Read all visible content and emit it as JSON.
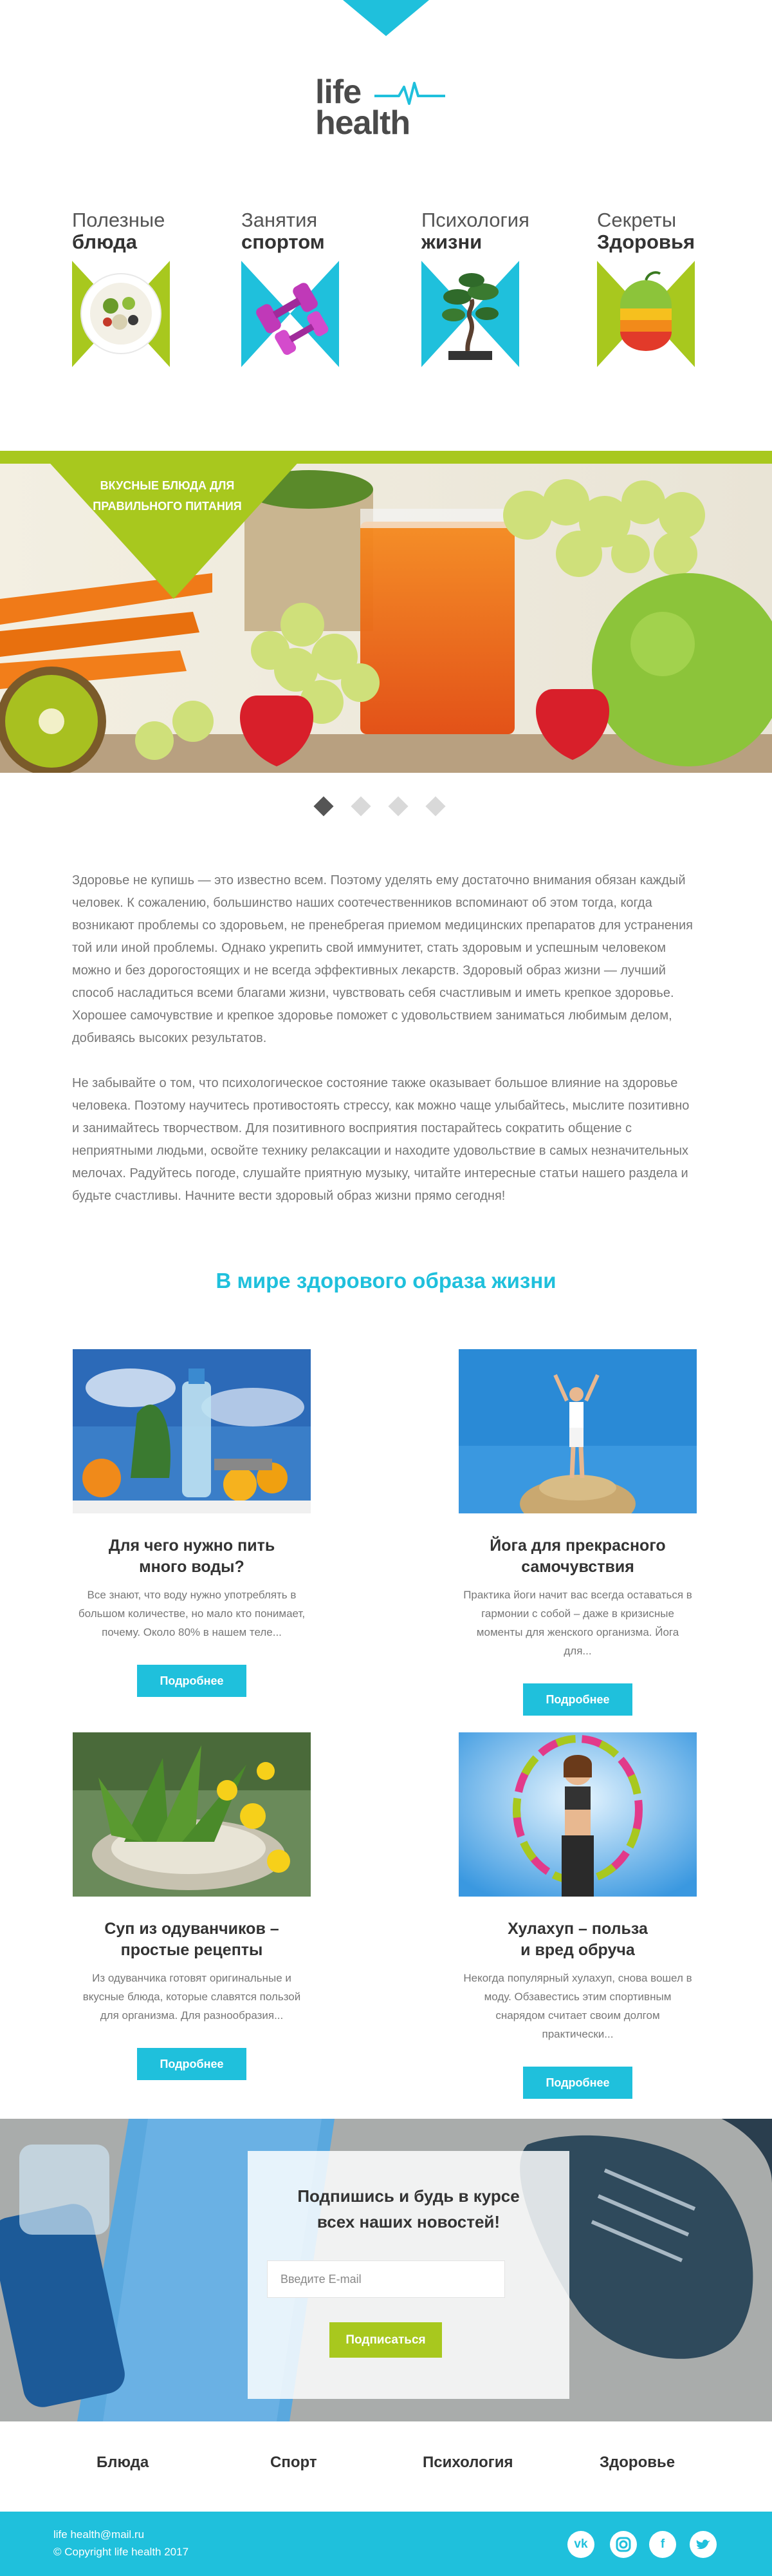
{
  "logo": {
    "word1": "life",
    "word2": "health"
  },
  "categories": [
    {
      "line1": "Полезные",
      "line2": "блюда",
      "icon": "salad-icon"
    },
    {
      "line1": "Занятия",
      "line2": "спортом",
      "icon": "dumbbell-icon"
    },
    {
      "line1": "Психология",
      "line2": "жизни",
      "icon": "bonsai-icon"
    },
    {
      "line1": "Секреты",
      "line2": "Здоровья",
      "icon": "fruit-icon"
    }
  ],
  "hero": {
    "badge_line1": "ВКУСНЫЕ БЛЮДА ДЛЯ",
    "badge_line2": "ПРАВИЛЬНОГО ПИТАНИЯ",
    "slides_total": 4,
    "active_slide": 1
  },
  "intro": {
    "p1": "Здоровье не купишь — это известно всем. Поэтому уделять ему достаточно внимания обязан каждый человек. К сожалению, большинство наших соотечественников вспоминают об этом тогда, когда возникают проблемы со здоровьем, не пренебрегая приемом медицинских препаратов для устранения той или иной проблемы. Однако укрепить свой иммунитет, стать здоровым и успешным человеком можно и без дорогостоящих и не всегда эффективных лекарств. Здоровый образ жизни — лучший способ насладиться всеми благами жизни, чувствовать себя счастливым и иметь крепкое здоровье. Хорошее самочувствие и крепкое здоровье поможет с удовольствием заниматься любимым делом, добиваясь высоких результатов.",
    "p2": "Не забывайте о том, что психологическое состояние также оказывает большое влияние на здоровье человека. Поэтому научитесь противостоять стрессу, как можно чаще улыбайтесь, мыслите позитивно и занимайтесь творчеством. Для позитивного восприятия постарайтесь сократить общение с неприятными людьми, освойте технику релаксации и находите удовольствие в самых незначительных мелочах. Радуйтесь погоде, слушайте приятную музыку, читайте интересные статьи нашего раздела и будьте счастливы. Начните вести здоровый образ жизни прямо сегодня!"
  },
  "section_title": "В мире здорового образа жизни",
  "articles": [
    {
      "title_l1": "Для чего нужно пить",
      "title_l2": "много воды?",
      "desc": "Все знают, что воду нужно употреблять в большом количестве, но мало кто понимает, почему. Около 80% в нашем теле...",
      "button": "Подробнее"
    },
    {
      "title_l1": "Йога для прекрасного",
      "title_l2": "самочувствия",
      "desc": "Практика йоги начит вас всегда оставаться в гармонии с собой – даже в кризисные моменты для женского организма. Йога для...",
      "button": "Подробнее"
    },
    {
      "title_l1": "Суп из одуванчиков –",
      "title_l2": "простые рецепты",
      "desc": "Из одуванчика готовят оригинальные и вкусные блюда, которые славятся пользой для организма. Для разнообразия...",
      "button": "Подробнее"
    },
    {
      "title_l1": "Хулахуп – польза",
      "title_l2": "и вред обруча",
      "desc": "Некогда популярный хулахуп, снова вошел в моду. Обзавестись этим спортивным снарядом считает своим долгом практически...",
      "button": "Подробнее"
    }
  ],
  "subscribe": {
    "heading_l1": "Подпишись и будь в курсе",
    "heading_l2": "всех наших новостей!",
    "email_placeholder": "Введите E-mail",
    "button": "Подписаться"
  },
  "footer_nav": [
    "Блюда",
    "Спорт",
    "Психология",
    "Здоровье"
  ],
  "footer": {
    "email": "life health@mail.ru",
    "copyright": "© Copyright life health 2017",
    "social": [
      "vk-icon",
      "instagram-icon",
      "facebook-icon",
      "twitter-icon"
    ]
  },
  "colors": {
    "accent": "#1fc0dc",
    "green": "#a8c81e",
    "dark": "#4a4a4a"
  }
}
